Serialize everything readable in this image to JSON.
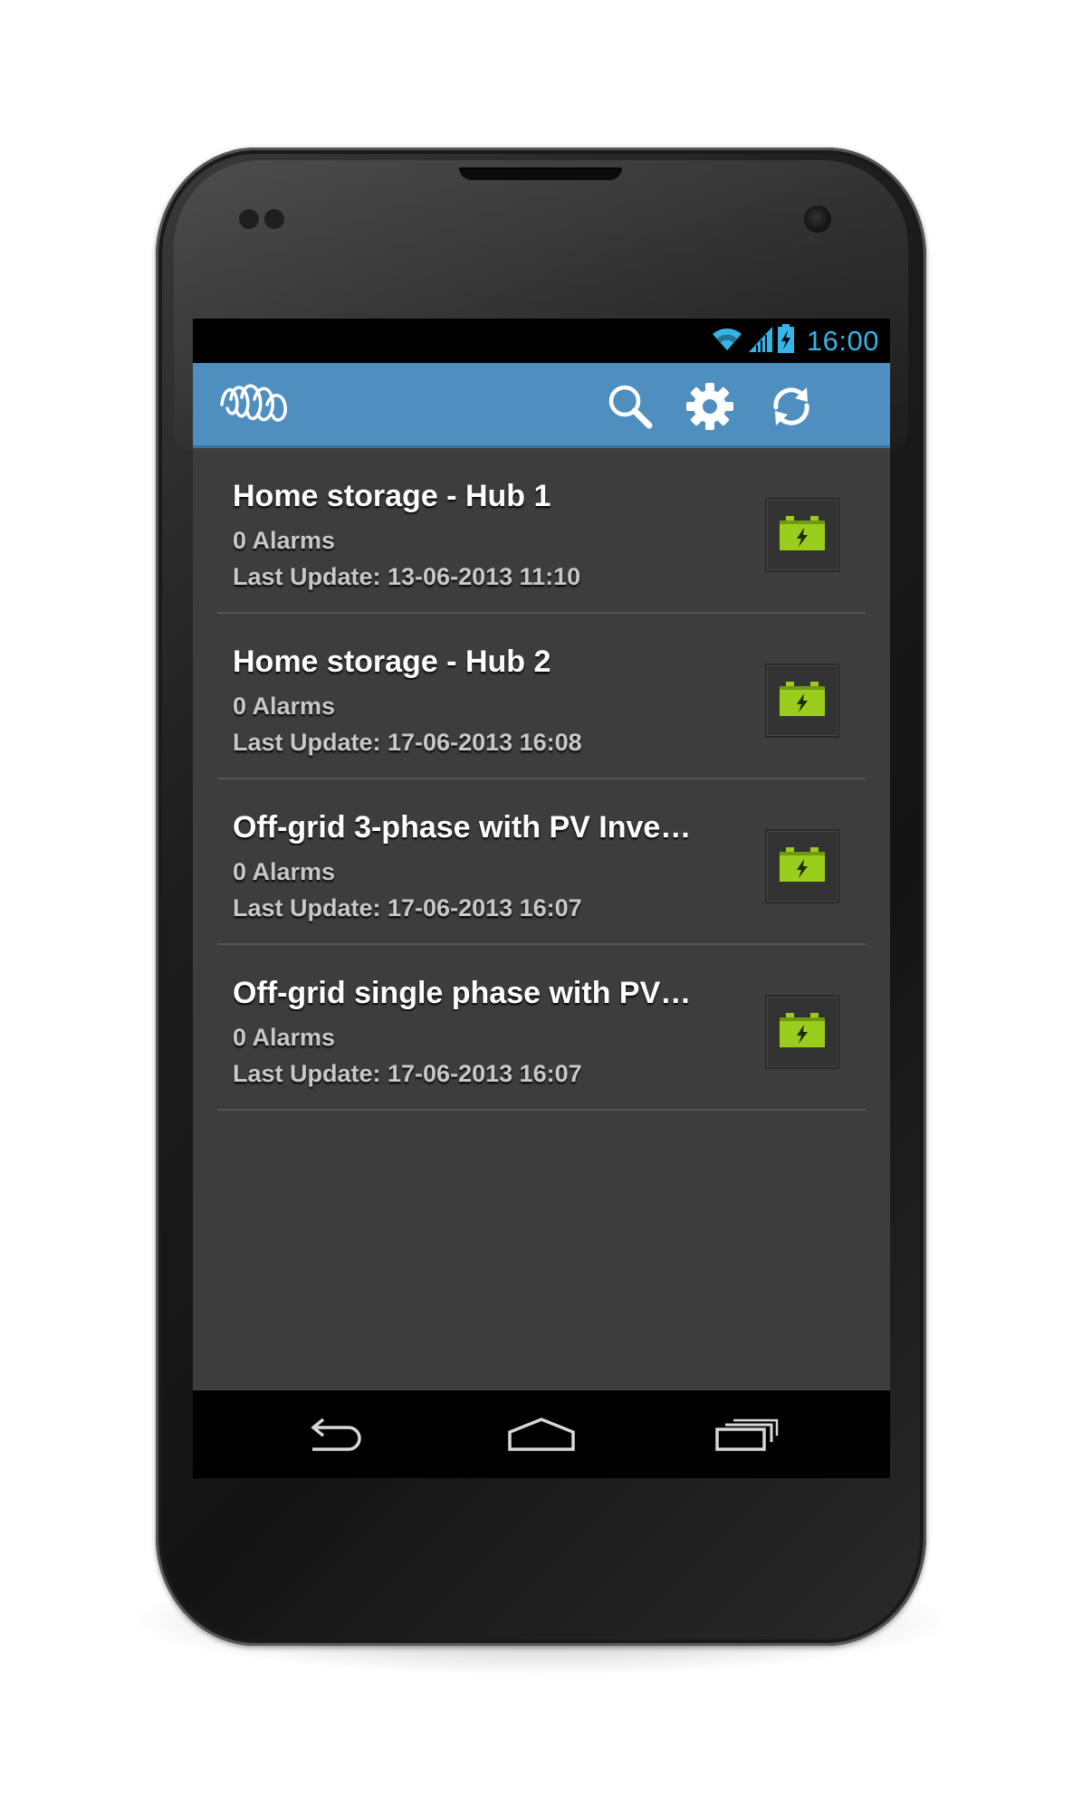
{
  "status_bar": {
    "time": "16:00",
    "icons": [
      "wifi-icon",
      "signal-icon",
      "battery-charging-icon"
    ],
    "time_color": "#33b5e5"
  },
  "action_bar": {
    "logo": "victron-logo",
    "actions": [
      "search-icon",
      "gear-icon",
      "refresh-icon"
    ],
    "color": "#4e8fbf"
  },
  "sites": [
    {
      "title": "Home storage - Hub 1",
      "alarms": "0 Alarms",
      "last_update": "Last Update: 13-06-2013 11:10"
    },
    {
      "title": "Home storage - Hub 2",
      "alarms": "0 Alarms",
      "last_update": "Last Update: 17-06-2013 16:08"
    },
    {
      "title": "Off-grid 3-phase with PV Inve…",
      "alarms": "0 Alarms",
      "last_update": "Last Update: 17-06-2013 16:07"
    },
    {
      "title": "Off-grid single phase with PV…",
      "alarms": "0 Alarms",
      "last_update": "Last Update: 17-06-2013 16:07"
    }
  ],
  "site_status_icon": "battery-icon",
  "battery_color": "#9acd1c",
  "nav_bar": {
    "buttons": [
      "back-icon",
      "home-icon",
      "recent-apps-icon"
    ]
  }
}
